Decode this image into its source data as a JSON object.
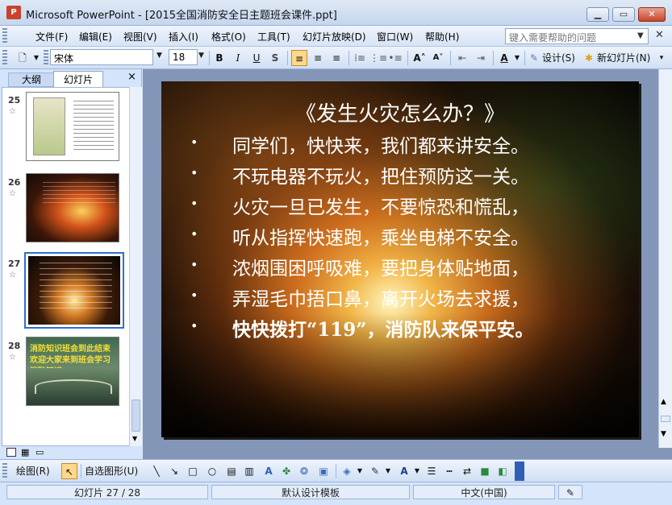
{
  "window": {
    "title": "Microsoft PowerPoint - [2015全国消防安全日主题班会课件.ppt]",
    "minimize": "▁",
    "maximize": "▭",
    "close": "✕"
  },
  "menu": {
    "items": [
      "文件(F)",
      "编辑(E)",
      "视图(V)",
      "插入(I)",
      "格式(O)",
      "工具(T)",
      "幻灯片放映(D)",
      "窗口(W)",
      "帮助(H)"
    ],
    "help_placeholder": "键入需要帮助的问题"
  },
  "toolbar": {
    "font_name": "宋体",
    "font_size": "18",
    "bold": "B",
    "italic": "I",
    "underline": "U",
    "shadow": "S",
    "font_color": "A",
    "design_label": "设计(S)",
    "new_slide_label": "新幻灯片(N)"
  },
  "outline_panel": {
    "tabs": [
      "大纲",
      "幻灯片"
    ],
    "close": "×",
    "thumbnails": [
      {
        "number": "25",
        "content": "image"
      },
      {
        "number": "26",
        "content": "image"
      },
      {
        "number": "27",
        "content": "current slide",
        "selected": true
      },
      {
        "number": "28",
        "content": "image",
        "text": "消防知识班会到此结束 欢迎大家来到班会学习消防知识"
      }
    ]
  },
  "slide": {
    "title": "《发生火灾怎么办？》",
    "bullet_char": "•",
    "lines": [
      "同学们，快快来，我们都来讲安全。",
      "不玩电器不玩火，把住预防这一关。",
      "火灾一旦已发生，不要惊恐和慌乱，",
      "听从指挥快速跑，乘坐电梯不安全。",
      "浓烟围困呼吸难，要把身体贴地面，",
      "弄湿毛巾捂口鼻，离开火场去求援，",
      "快快拨打“119”，消防队来保平安。"
    ]
  },
  "drawing_toolbar": {
    "draw_label": "绘图(R)",
    "autoshape_label": "自选图形(U)"
  },
  "status": {
    "slide_info": "幻灯片 27 / 28",
    "template": "默认设计模板",
    "language": "中文(中国)"
  },
  "colors": {
    "selection_border": "#2f6fd1",
    "active_button": "#ffd889"
  }
}
